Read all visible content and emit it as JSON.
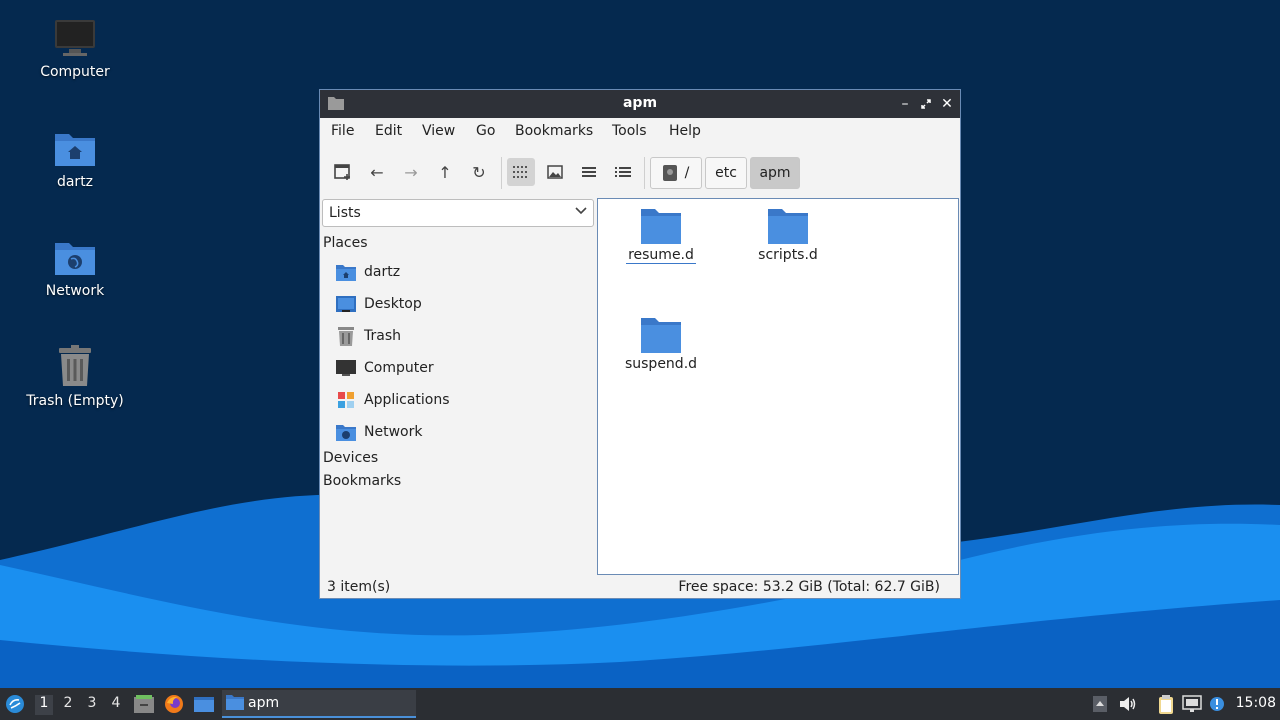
{
  "desktop": {
    "icons": [
      {
        "label": "Computer",
        "icon": "computer-icon"
      },
      {
        "label": "dartz",
        "icon": "home-folder-icon"
      },
      {
        "label": "Network",
        "icon": "network-folder-icon"
      },
      {
        "label": "Trash (Empty)",
        "icon": "trash-icon"
      }
    ]
  },
  "window": {
    "title": "apm",
    "menu": [
      "File",
      "Edit",
      "View",
      "Go",
      "Bookmarks",
      "Tools",
      "Help"
    ],
    "breadcrumbs": [
      "/",
      "etc",
      "apm"
    ],
    "sidebar": {
      "mode": "Lists",
      "places_header": "Places",
      "places": [
        {
          "label": "dartz",
          "icon": "home-folder-icon"
        },
        {
          "label": "Desktop",
          "icon": "desktop-icon"
        },
        {
          "label": "Trash",
          "icon": "trash-icon"
        },
        {
          "label": "Computer",
          "icon": "computer-icon"
        },
        {
          "label": "Applications",
          "icon": "applications-icon"
        },
        {
          "label": "Network",
          "icon": "network-folder-icon"
        }
      ],
      "devices_header": "Devices",
      "bookmarks_header": "Bookmarks"
    },
    "files": [
      {
        "name": "resume.d",
        "selected": true
      },
      {
        "name": "scripts.d",
        "selected": false
      },
      {
        "name": "suspend.d",
        "selected": false
      }
    ],
    "status": {
      "items": "3 item(s)",
      "free_space": "Free space: 53.2 GiB (Total: 62.7 GiB)"
    }
  },
  "taskbar": {
    "workspaces": [
      "1",
      "2",
      "3",
      "4"
    ],
    "active_workspace": "1",
    "task_label": "apm",
    "clock": "15:08"
  },
  "colors": {
    "wallpaper_dark": "#05294f",
    "wave_light": "#1a8ff0",
    "folder_blue": "#4a8fe0",
    "titlebar": "#2e3138",
    "taskbar": "#2b2e33"
  }
}
